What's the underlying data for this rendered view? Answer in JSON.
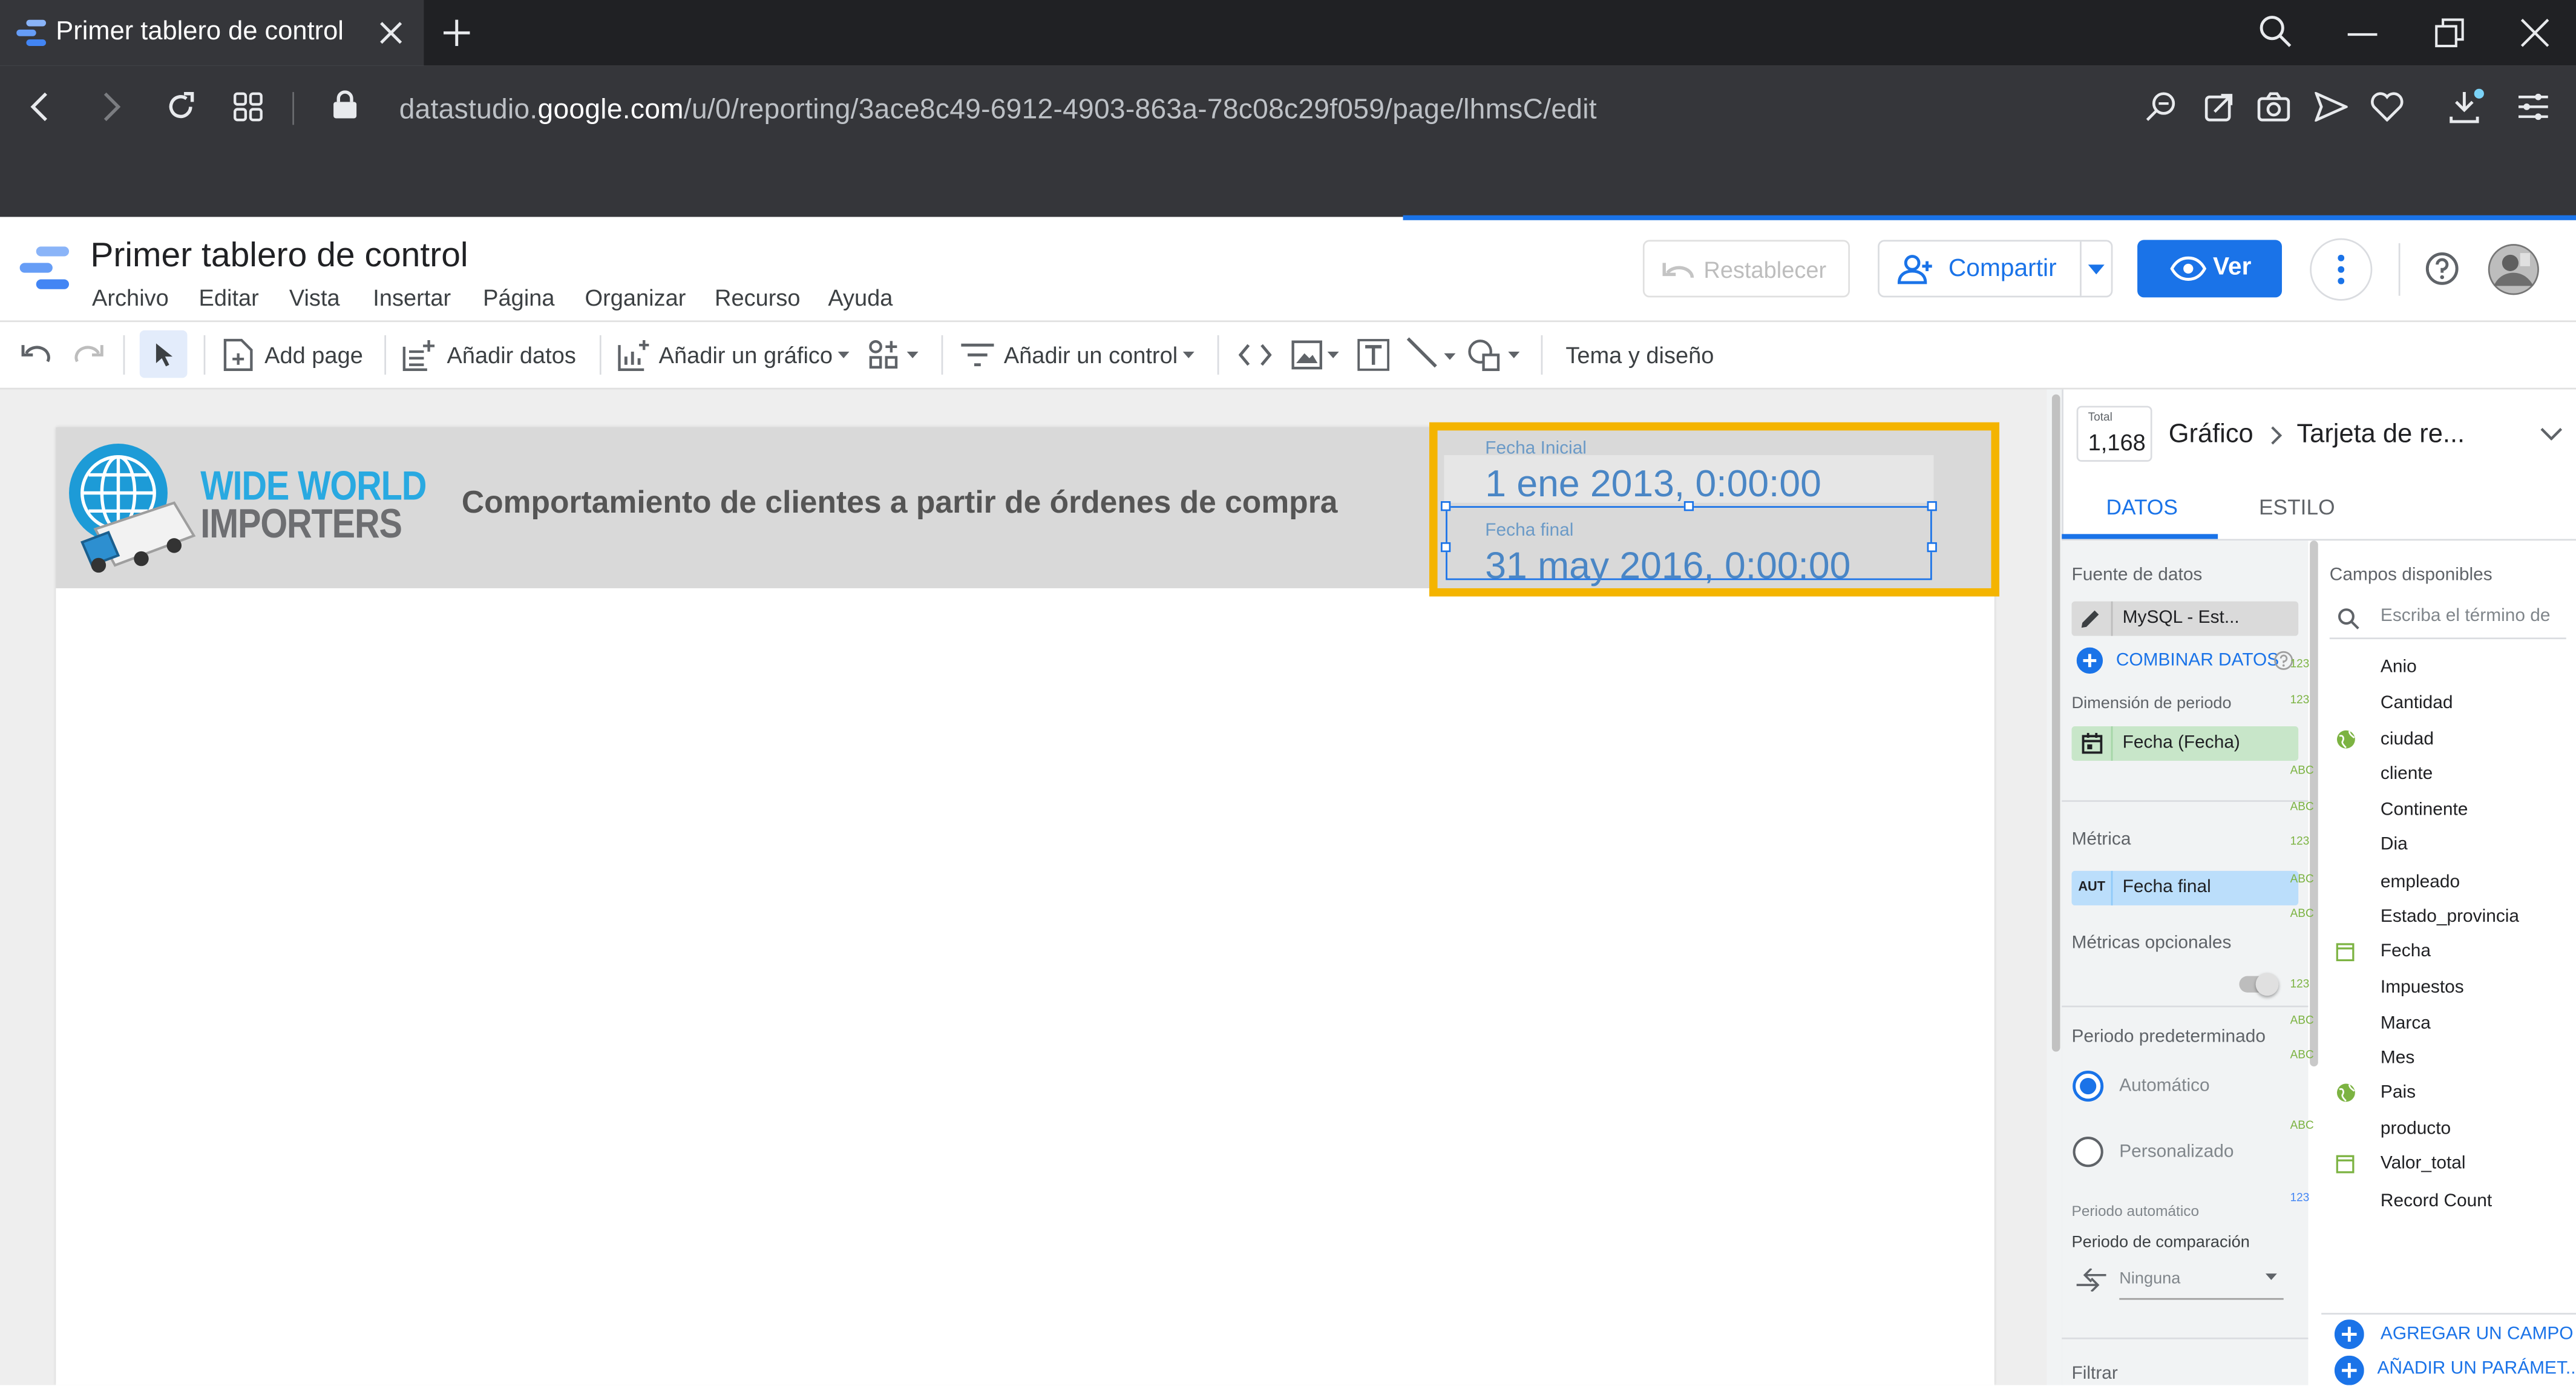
{
  "browser": {
    "tab_title": "Primer tablero de control",
    "url_prefix": "datastudio.",
    "url_domain": "google.com",
    "url_path": "/u/0/reporting/3ace8c49-6912-4903-863a-78c08c29f059/page/lhmsC/edit"
  },
  "app": {
    "title": "Primer tablero de control",
    "menu": [
      "Archivo",
      "Editar",
      "Vista",
      "Insertar",
      "Página",
      "Organizar",
      "Recurso",
      "Ayuda"
    ],
    "restore_label": "Restablecer",
    "share_label": "Compartir",
    "view_label": "Ver"
  },
  "toolbar": {
    "add_page": "Add page",
    "add_data": "Añadir datos",
    "add_chart": "Añadir un gráfico",
    "add_control": "Añadir un control",
    "theme": "Tema y diseño"
  },
  "report": {
    "logo_line1": "WIDE WORLD",
    "logo_line2": "IMPORTERS",
    "title": "Comportamiento de clientes a partir de órdenes de compra",
    "start_label": "Fecha Inicial",
    "start_value": "1 ene 2013, 0:00:00",
    "end_label": "Fecha final",
    "end_value": "31 may 2016, 0:00:00"
  },
  "panel": {
    "total_label": "Total",
    "total_value": "1,168",
    "breadcrumb_1": "Gráfico",
    "breadcrumb_2": "Tarjeta de re...",
    "tab_data": "DATOS",
    "tab_style": "ESTILO",
    "data_source_label": "Fuente de datos",
    "data_source_value": "MySQL - Est...",
    "blend_label": "COMBINAR DATOS",
    "period_dim_label": "Dimensión de periodo",
    "period_dim_value": "Fecha (Fecha)",
    "metric_label": "Métrica",
    "metric_type": "AUT",
    "metric_value": "Fecha final",
    "optional_metrics_label": "Métricas opcionales",
    "default_period_label": "Periodo predeterminado",
    "auto_option": "Automático",
    "custom_option": "Personalizado",
    "auto_period_label": "Periodo automático",
    "comparison_label": "Periodo de comparación",
    "comparison_value": "Ninguna",
    "filter_label": "Filtrar",
    "available_fields_label": "Campos disponibles",
    "search_placeholder": "Escriba el término de",
    "fields": [
      {
        "type": "123",
        "name": "Anio"
      },
      {
        "type": "123",
        "name": "Cantidad"
      },
      {
        "type": "geo",
        "name": "ciudad"
      },
      {
        "type": "ABC",
        "name": "cliente"
      },
      {
        "type": "ABC",
        "name": "Continente"
      },
      {
        "type": "123",
        "name": "Dia"
      },
      {
        "type": "ABC",
        "name": "empleado"
      },
      {
        "type": "ABC",
        "name": "Estado_provincia"
      },
      {
        "type": "date",
        "name": "Fecha"
      },
      {
        "type": "123",
        "name": "Impuestos"
      },
      {
        "type": "ABC",
        "name": "Marca"
      },
      {
        "type": "ABC",
        "name": "Mes"
      },
      {
        "type": "geo",
        "name": "Pais"
      },
      {
        "type": "ABC",
        "name": "producto"
      },
      {
        "type": "date",
        "name": "Valor_total"
      },
      {
        "type": "123",
        "name": "Record Count"
      }
    ],
    "add_field": "AGREGAR UN CAMPO",
    "add_param": "AÑADIR UN PARÁMET..."
  }
}
